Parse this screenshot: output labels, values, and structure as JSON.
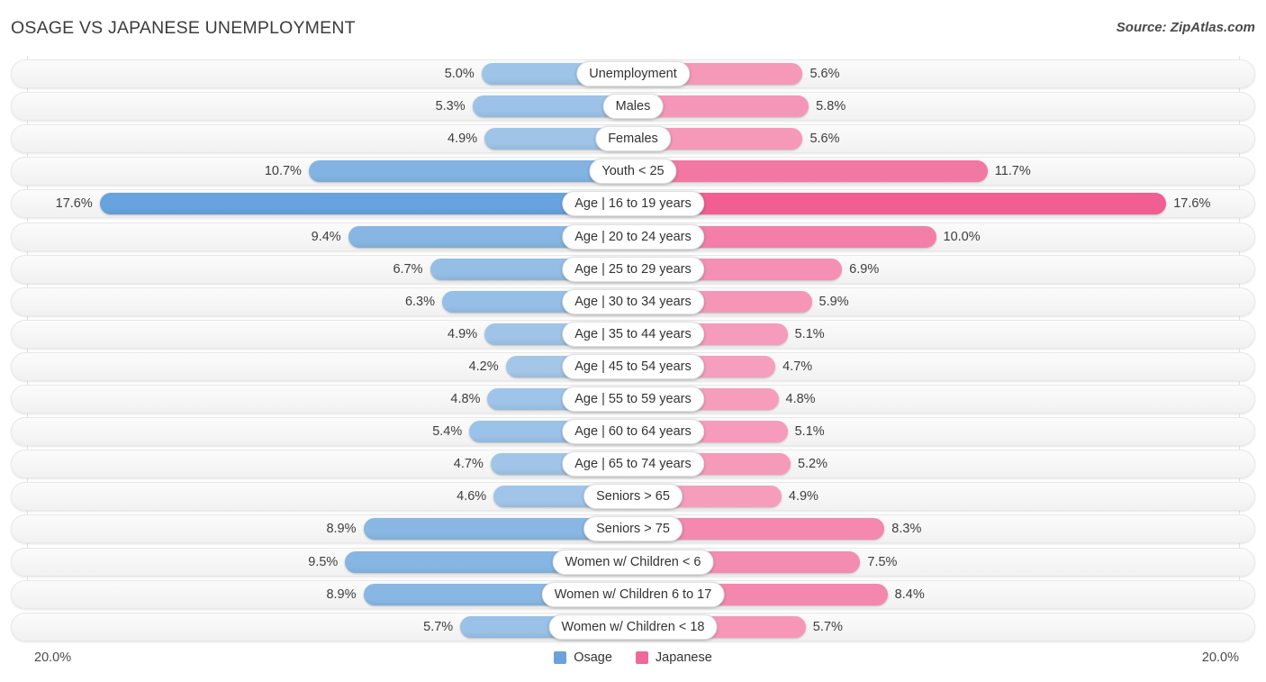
{
  "header": {
    "title": "OSAGE VS JAPANESE UNEMPLOYMENT",
    "source": "Source: ZipAtlas.com"
  },
  "axis": {
    "left_label": "20.0%",
    "right_label": "20.0%",
    "max": 20.0
  },
  "legend": {
    "items": [
      {
        "label": "Osage",
        "color": "#6aa2dd"
      },
      {
        "label": "Japanese",
        "color": "#f2679a"
      }
    ]
  },
  "chart_data": {
    "type": "bar",
    "subtype": "diverging-bar",
    "title": "OSAGE VS JAPANESE UNEMPLOYMENT",
    "xlabel": "",
    "ylabel": "",
    "unit": "%",
    "xlim": [
      -20.0,
      20.0
    ],
    "grid": true,
    "legend_position": "bottom-center",
    "categories": [
      "Unemployment",
      "Males",
      "Females",
      "Youth < 25",
      "Age | 16 to 19 years",
      "Age | 20 to 24 years",
      "Age | 25 to 29 years",
      "Age | 30 to 34 years",
      "Age | 35 to 44 years",
      "Age | 45 to 54 years",
      "Age | 55 to 59 years",
      "Age | 60 to 64 years",
      "Age | 65 to 74 years",
      "Seniors > 65",
      "Seniors > 75",
      "Women w/ Children < 6",
      "Women w/ Children 6 to 17",
      "Women w/ Children < 18"
    ],
    "series": [
      {
        "name": "Osage",
        "side": "left",
        "color": "#6aa2dd",
        "values": [
          5.0,
          5.3,
          4.9,
          10.7,
          17.6,
          9.4,
          6.7,
          6.3,
          4.9,
          4.2,
          4.8,
          5.4,
          4.7,
          4.6,
          8.9,
          9.5,
          8.9,
          5.7
        ],
        "labels": [
          "5.0%",
          "5.3%",
          "4.9%",
          "10.7%",
          "17.6%",
          "9.4%",
          "6.7%",
          "6.3%",
          "4.9%",
          "4.2%",
          "4.8%",
          "5.4%",
          "4.7%",
          "4.6%",
          "8.9%",
          "9.5%",
          "8.9%",
          "5.7%"
        ]
      },
      {
        "name": "Japanese",
        "side": "right",
        "color": "#f2679a",
        "values": [
          5.6,
          5.8,
          5.6,
          11.7,
          17.6,
          10.0,
          6.9,
          5.9,
          5.1,
          4.7,
          4.8,
          5.1,
          5.2,
          4.9,
          8.3,
          7.5,
          8.4,
          5.7
        ],
        "labels": [
          "5.6%",
          "5.8%",
          "5.6%",
          "11.7%",
          "17.6%",
          "10.0%",
          "6.9%",
          "5.9%",
          "5.1%",
          "4.7%",
          "4.8%",
          "5.1%",
          "5.2%",
          "4.9%",
          "8.3%",
          "7.5%",
          "8.4%",
          "5.7%"
        ]
      }
    ]
  },
  "colors": {
    "blue_light": "#a7c9ea",
    "blue_mid": "#8ab6e4",
    "blue_dark": "#5f9edc",
    "pink_light": "#f7a6c2",
    "pink_mid": "#f58aae",
    "pink_dark": "#ef5d90",
    "track": "#f4f4f4",
    "gridline": "#e3e3e3"
  }
}
